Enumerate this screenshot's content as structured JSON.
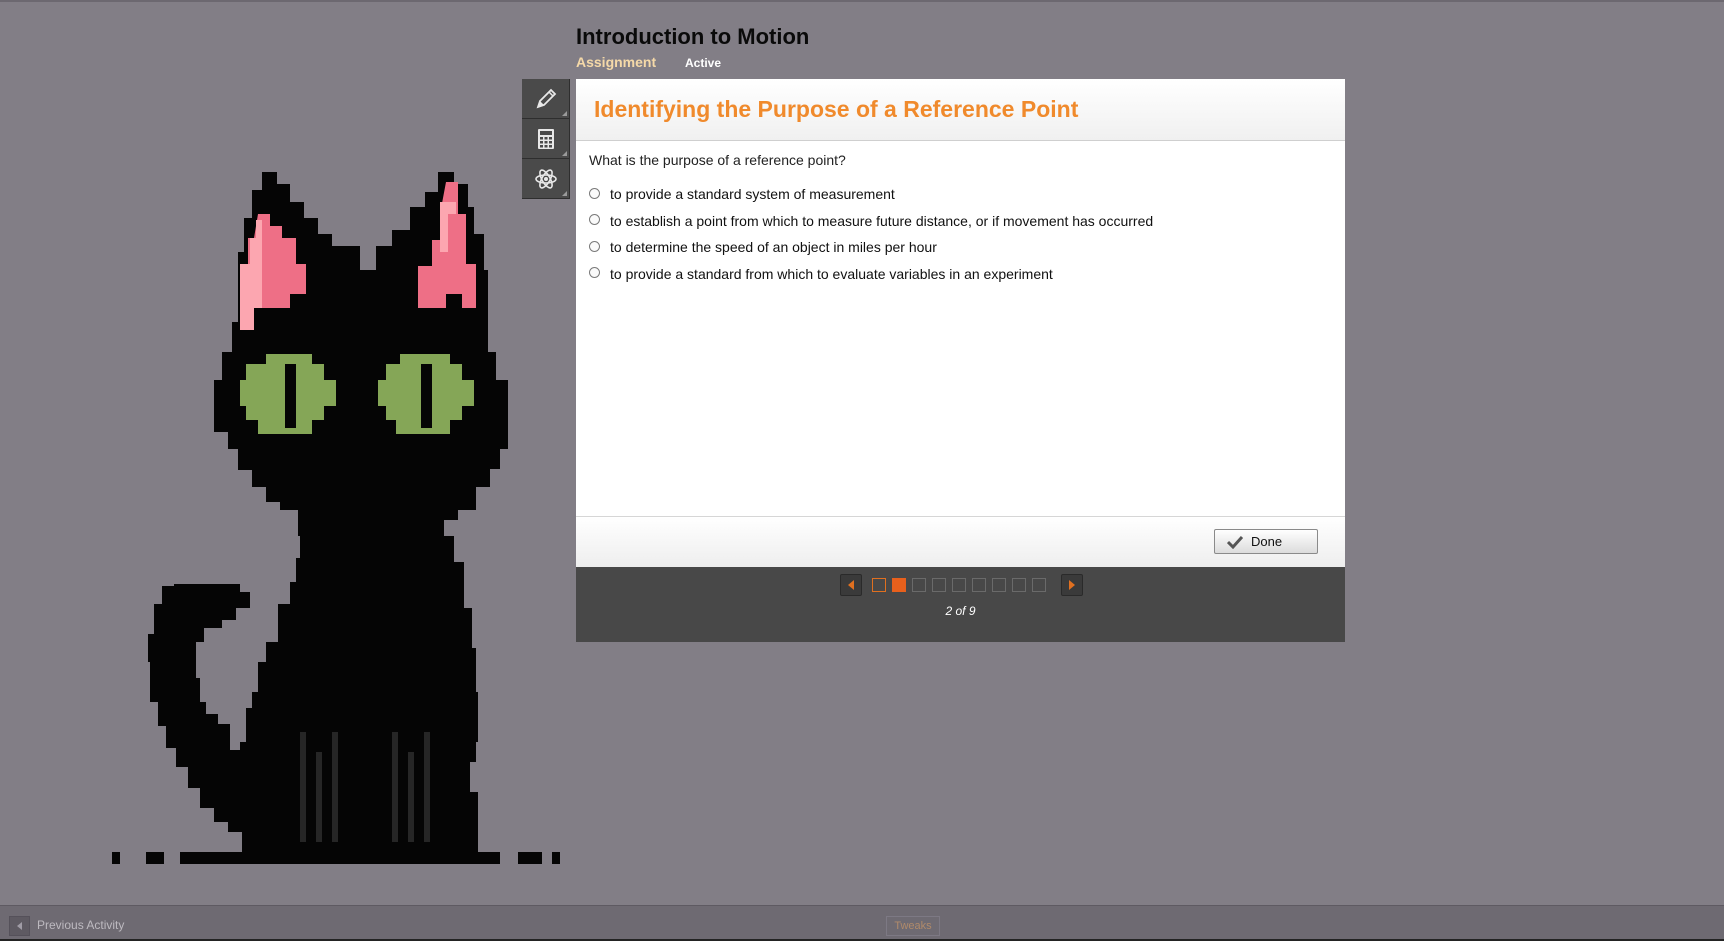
{
  "course": {
    "title": "Introduction to Motion",
    "assignment_tab": "Assignment",
    "status": "Active"
  },
  "toolbar": {
    "tools": [
      {
        "icon": "pencil-icon"
      },
      {
        "icon": "calculator-icon"
      },
      {
        "icon": "atom-icon"
      }
    ]
  },
  "question": {
    "heading": "Identifying the Purpose of a Reference Point",
    "prompt": "What is the purpose of a reference point?",
    "options": [
      "to provide a standard system of measurement",
      "to establish a point from which to measure future distance, or if movement has occurred",
      "to determine the speed of an object in miles per hour",
      "to provide a standard from which to evaluate variables in an experiment"
    ],
    "done_label": "Done"
  },
  "pager": {
    "current": 2,
    "total": 9,
    "label": "2 of 9"
  },
  "bottom_bar": {
    "previous_label": "Previous Activity",
    "tweaks_label": "Tweaks"
  },
  "colors": {
    "background": "#827e86",
    "heading_orange": "#f08a2c",
    "assignment_tab": "#f5d9a8",
    "pager_current": "#e8601c",
    "pager_bg": "#484848"
  }
}
